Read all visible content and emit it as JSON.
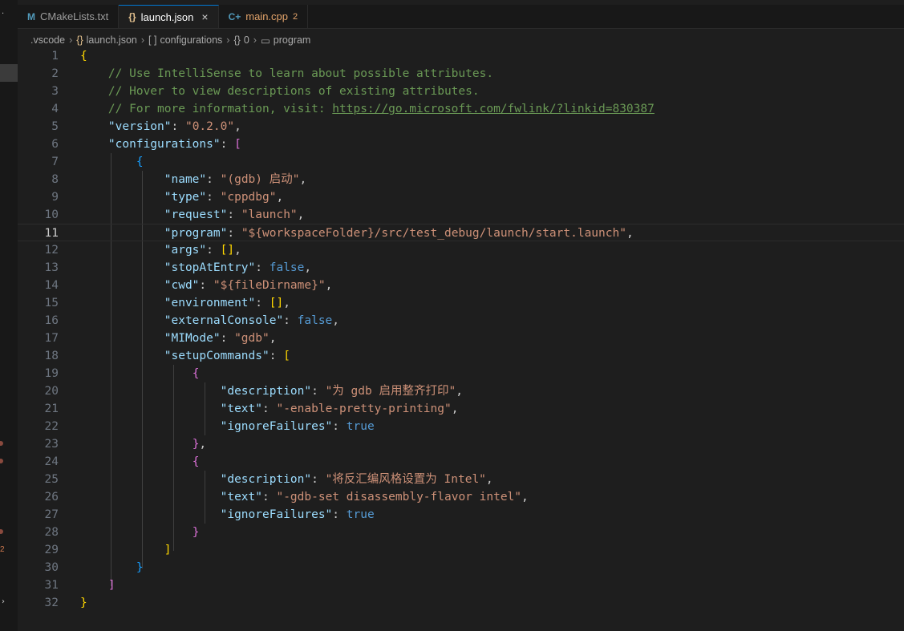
{
  "tabs": [
    {
      "icon": "M",
      "label": "CMakeLists.txt",
      "active": false
    },
    {
      "icon": "{}",
      "label": "launch.json",
      "active": true,
      "close": "×"
    },
    {
      "icon": "C+",
      "label": "main.cpp",
      "active": false,
      "badge": "2"
    }
  ],
  "breadcrumb": [
    {
      "icon": "",
      "label": ".vscode"
    },
    {
      "icon": "{}",
      "label": "launch.json"
    },
    {
      "icon": "[ ]",
      "label": "configurations"
    },
    {
      "icon": "{}",
      "label": "0"
    },
    {
      "icon": "▭",
      "label": "program"
    }
  ],
  "activity": {
    "problems_count": "2"
  },
  "editor": {
    "current_line": 11,
    "lines": [
      {
        "n": "1",
        "t": [
          [
            "{",
            "b-y"
          ]
        ]
      },
      {
        "n": "2",
        "t": [
          [
            "    ",
            ""
          ],
          [
            "// Use IntelliSense to learn about possible attributes.",
            "c-comment"
          ]
        ]
      },
      {
        "n": "3",
        "t": [
          [
            "    ",
            ""
          ],
          [
            "// Hover to view descriptions of existing attributes.",
            "c-comment"
          ]
        ]
      },
      {
        "n": "4",
        "t": [
          [
            "    ",
            ""
          ],
          [
            "// For more information, visit: ",
            "c-comment"
          ],
          [
            "https://go.microsoft.com/fwlink/?linkid=830387",
            "c-link"
          ]
        ]
      },
      {
        "n": "5",
        "t": [
          [
            "    ",
            ""
          ],
          [
            "\"version\"",
            "c-key"
          ],
          [
            ": ",
            "c-p"
          ],
          [
            "\"0.2.0\"",
            "c-str"
          ],
          [
            ",",
            "c-p"
          ]
        ]
      },
      {
        "n": "6",
        "t": [
          [
            "    ",
            ""
          ],
          [
            "\"configurations\"",
            "c-key"
          ],
          [
            ": ",
            "c-p"
          ],
          [
            "[",
            "b-m"
          ]
        ]
      },
      {
        "n": "7",
        "t": [
          [
            "        ",
            ""
          ],
          [
            "{",
            "b-b"
          ]
        ]
      },
      {
        "n": "8",
        "t": [
          [
            "            ",
            ""
          ],
          [
            "\"name\"",
            "c-key"
          ],
          [
            ": ",
            "c-p"
          ],
          [
            "\"(gdb) 启动\"",
            "c-str"
          ],
          [
            ",",
            "c-p"
          ]
        ]
      },
      {
        "n": "9",
        "t": [
          [
            "            ",
            ""
          ],
          [
            "\"type\"",
            "c-key"
          ],
          [
            ": ",
            "c-p"
          ],
          [
            "\"cppdbg\"",
            "c-str"
          ],
          [
            ",",
            "c-p"
          ]
        ]
      },
      {
        "n": "10",
        "t": [
          [
            "            ",
            ""
          ],
          [
            "\"request\"",
            "c-key"
          ],
          [
            ": ",
            "c-p"
          ],
          [
            "\"launch\"",
            "c-str"
          ],
          [
            ",",
            "c-p"
          ]
        ]
      },
      {
        "n": "11",
        "t": [
          [
            "            ",
            ""
          ],
          [
            "\"program\"",
            "c-key"
          ],
          [
            ": ",
            "c-p"
          ],
          [
            "\"${workspaceFolder}/src/test_debug/launch/start.launch\"",
            "c-str"
          ],
          [
            ",",
            "c-p"
          ]
        ]
      },
      {
        "n": "12",
        "t": [
          [
            "            ",
            ""
          ],
          [
            "\"args\"",
            "c-key"
          ],
          [
            ": ",
            "c-p"
          ],
          [
            "[]",
            "b-y"
          ],
          [
            ",",
            "c-p"
          ]
        ]
      },
      {
        "n": "13",
        "t": [
          [
            "            ",
            ""
          ],
          [
            "\"stopAtEntry\"",
            "c-key"
          ],
          [
            ": ",
            "c-p"
          ],
          [
            "false",
            "c-kw"
          ],
          [
            ",",
            "c-p"
          ]
        ]
      },
      {
        "n": "14",
        "t": [
          [
            "            ",
            ""
          ],
          [
            "\"cwd\"",
            "c-key"
          ],
          [
            ": ",
            "c-p"
          ],
          [
            "\"${fileDirname}\"",
            "c-str"
          ],
          [
            ",",
            "c-p"
          ]
        ]
      },
      {
        "n": "15",
        "t": [
          [
            "            ",
            ""
          ],
          [
            "\"environment\"",
            "c-key"
          ],
          [
            ": ",
            "c-p"
          ],
          [
            "[]",
            "b-y"
          ],
          [
            ",",
            "c-p"
          ]
        ]
      },
      {
        "n": "16",
        "t": [
          [
            "            ",
            ""
          ],
          [
            "\"externalConsole\"",
            "c-key"
          ],
          [
            ": ",
            "c-p"
          ],
          [
            "false",
            "c-kw"
          ],
          [
            ",",
            "c-p"
          ]
        ]
      },
      {
        "n": "17",
        "t": [
          [
            "            ",
            ""
          ],
          [
            "\"MIMode\"",
            "c-key"
          ],
          [
            ": ",
            "c-p"
          ],
          [
            "\"gdb\"",
            "c-str"
          ],
          [
            ",",
            "c-p"
          ]
        ]
      },
      {
        "n": "18",
        "t": [
          [
            "            ",
            ""
          ],
          [
            "\"setupCommands\"",
            "c-key"
          ],
          [
            ": ",
            "c-p"
          ],
          [
            "[",
            "b-y"
          ]
        ]
      },
      {
        "n": "19",
        "t": [
          [
            "                ",
            ""
          ],
          [
            "{",
            "b-m"
          ]
        ]
      },
      {
        "n": "20",
        "t": [
          [
            "                    ",
            ""
          ],
          [
            "\"description\"",
            "c-key"
          ],
          [
            ": ",
            "c-p"
          ],
          [
            "\"为 gdb 启用整齐打印\"",
            "c-str"
          ],
          [
            ",",
            "c-p"
          ]
        ]
      },
      {
        "n": "21",
        "t": [
          [
            "                    ",
            ""
          ],
          [
            "\"text\"",
            "c-key"
          ],
          [
            ": ",
            "c-p"
          ],
          [
            "\"-enable-pretty-printing\"",
            "c-str"
          ],
          [
            ",",
            "c-p"
          ]
        ]
      },
      {
        "n": "22",
        "t": [
          [
            "                    ",
            ""
          ],
          [
            "\"ignoreFailures\"",
            "c-key"
          ],
          [
            ": ",
            "c-p"
          ],
          [
            "true",
            "c-kw"
          ]
        ]
      },
      {
        "n": "23",
        "t": [
          [
            "                ",
            ""
          ],
          [
            "}",
            "b-m"
          ],
          [
            ",",
            "c-p"
          ]
        ]
      },
      {
        "n": "24",
        "t": [
          [
            "                ",
            ""
          ],
          [
            "{",
            "b-m"
          ]
        ]
      },
      {
        "n": "25",
        "t": [
          [
            "                    ",
            ""
          ],
          [
            "\"description\"",
            "c-key"
          ],
          [
            ": ",
            "c-p"
          ],
          [
            "\"将反汇编风格设置为 Intel\"",
            "c-str"
          ],
          [
            ",",
            "c-p"
          ]
        ]
      },
      {
        "n": "26",
        "t": [
          [
            "                    ",
            ""
          ],
          [
            "\"text\"",
            "c-key"
          ],
          [
            ": ",
            "c-p"
          ],
          [
            "\"-gdb-set disassembly-flavor intel\"",
            "c-str"
          ],
          [
            ",",
            "c-p"
          ]
        ]
      },
      {
        "n": "27",
        "t": [
          [
            "                    ",
            ""
          ],
          [
            "\"ignoreFailures\"",
            "c-key"
          ],
          [
            ": ",
            "c-p"
          ],
          [
            "true",
            "c-kw"
          ]
        ]
      },
      {
        "n": "28",
        "t": [
          [
            "                ",
            ""
          ],
          [
            "}",
            "b-m"
          ]
        ]
      },
      {
        "n": "29",
        "t": [
          [
            "            ",
            ""
          ],
          [
            "]",
            "b-y"
          ]
        ]
      },
      {
        "n": "30",
        "t": [
          [
            "        ",
            ""
          ],
          [
            "}",
            "b-b"
          ]
        ]
      },
      {
        "n": "31",
        "t": [
          [
            "    ",
            ""
          ],
          [
            "]",
            "b-m"
          ]
        ]
      },
      {
        "n": "32",
        "t": [
          [
            "}",
            "b-y"
          ]
        ]
      }
    ]
  }
}
